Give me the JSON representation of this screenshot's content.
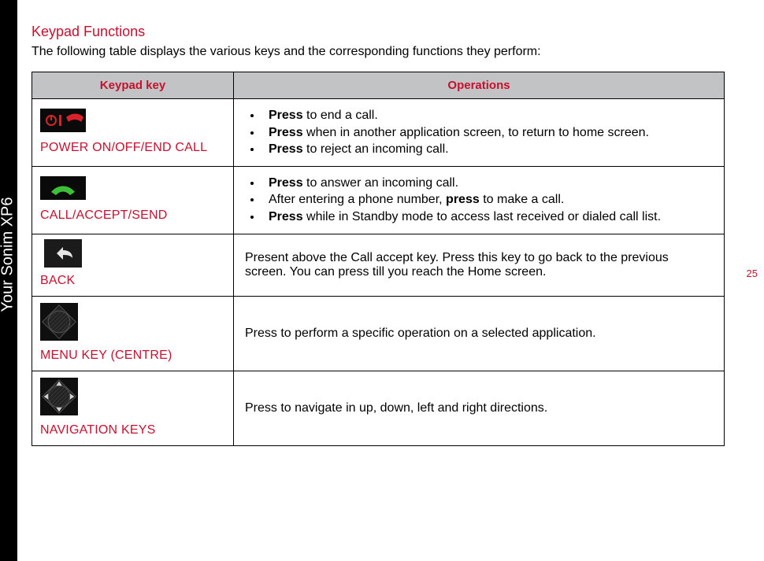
{
  "sidebar": {
    "label": "Your Sonim XP6"
  },
  "page_number": "25",
  "section": {
    "title": "Keypad Functions",
    "intro": "The following table displays the various keys and the corresponding functions they perform:"
  },
  "table": {
    "headers": {
      "key": "Keypad key",
      "ops": "Operations"
    },
    "rows": [
      {
        "icon": "end-call",
        "label": "POWER ON/OFF/END CALL",
        "ops": [
          {
            "bold_lead": "Press",
            "rest": " to end a call."
          },
          {
            "bold_lead": "Press",
            "rest": " when in another application screen, to return to home screen."
          },
          {
            "bold_lead": "Press",
            "rest": " to reject an incoming call."
          }
        ]
      },
      {
        "icon": "accept-call",
        "label": "CALL/ACCEPT/SEND",
        "ops": [
          {
            "bold_lead": "Press",
            "rest": " to answer an incoming call."
          },
          {
            "plain_lead": "After entering a phone number, ",
            "bold_mid": "press",
            "rest": " to make a call."
          },
          {
            "bold_lead": "Press",
            "rest": " while in Standby mode to access last received or dialed call list."
          }
        ]
      },
      {
        "icon": "back",
        "label": "BACK",
        "text": "Present above the Call accept key. Press this key to go back to the previous screen. You can press till you reach the Home screen."
      },
      {
        "icon": "menu-center",
        "label": "MENU KEY (CENTRE)",
        "text": "Press to perform a specific operation on a selected application."
      },
      {
        "icon": "nav-keys",
        "label": "NAVIGATION KEYS",
        "text": "Press to navigate in up, down, left and right directions."
      }
    ]
  }
}
